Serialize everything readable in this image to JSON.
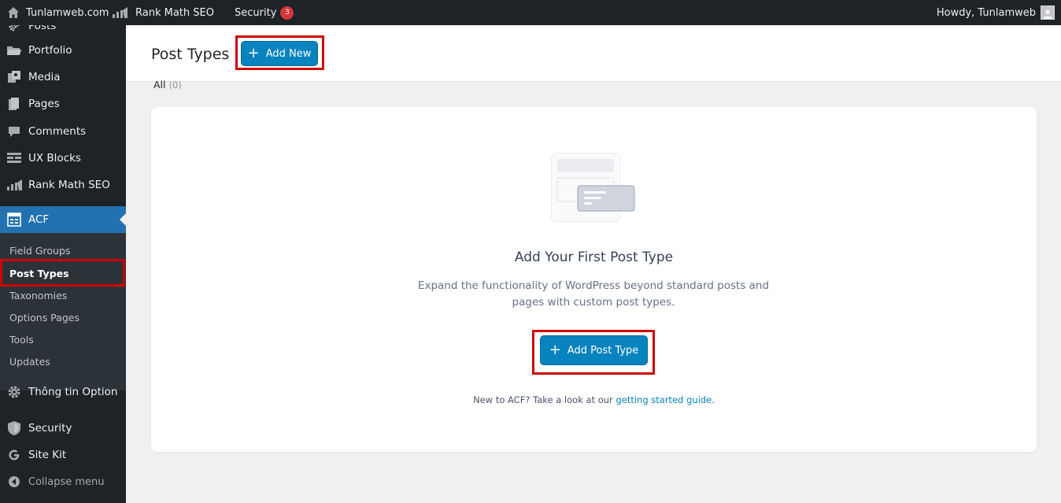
{
  "adminbar": {
    "site_name": "Tunlamweb.com",
    "rank_math": "Rank Math SEO",
    "security": "Security",
    "security_count": "3",
    "howdy": "Howdy, Tunlamweb"
  },
  "sidebar": {
    "items": [
      {
        "label": "Posts",
        "icon": "pin-icon"
      },
      {
        "label": "Portfolio",
        "icon": "folder-icon"
      },
      {
        "label": "Media",
        "icon": "media-icon"
      },
      {
        "label": "Pages",
        "icon": "pages-icon"
      },
      {
        "label": "Comments",
        "icon": "comment-icon"
      },
      {
        "label": "UX Blocks",
        "icon": "blocks-icon"
      },
      {
        "label": "Rank Math SEO",
        "icon": "chart-icon"
      },
      {
        "label": "ACF",
        "icon": "acf-icon"
      },
      {
        "label": "Thông tin Option",
        "icon": "gear-icon"
      },
      {
        "label": "Security",
        "icon": "shield-icon"
      },
      {
        "label": "Site Kit",
        "icon": "google-icon"
      },
      {
        "label": "Collapse menu",
        "icon": "collapse-icon"
      }
    ],
    "submenu": [
      "Field Groups",
      "Post Types",
      "Taxonomies",
      "Options Pages",
      "Tools",
      "Updates"
    ]
  },
  "header": {
    "title": "Post Types",
    "add_new": "Add New"
  },
  "filter": {
    "all_label": "All",
    "all_count": "(0)"
  },
  "empty_state": {
    "title": "Add Your First Post Type",
    "description": "Expand the functionality of WordPress beyond standard posts and pages with custom post types.",
    "button": "Add Post Type",
    "foot_text": "New to ACF? Take a look at our",
    "foot_link": "getting started guide",
    "foot_end": "."
  },
  "colors": {
    "primary": "#0783be",
    "sidebar_bg": "#1d2327",
    "active": "#2271b1",
    "highlight": "#d00000"
  }
}
